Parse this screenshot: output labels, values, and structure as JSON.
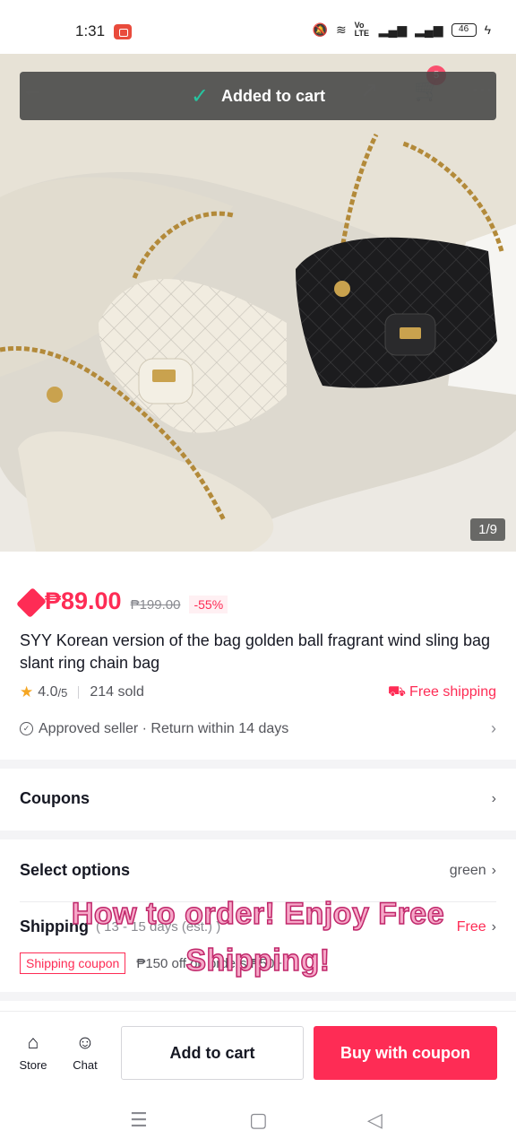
{
  "status_bar": {
    "time": "1:31",
    "network_label": "Vo LTE",
    "battery": "46"
  },
  "toast": {
    "text": "Added to cart"
  },
  "header_icons": {
    "back": "back-arrow-icon",
    "share": "share-icon",
    "cart": "cart-icon",
    "more": "more-icon",
    "cart_badge": "5"
  },
  "gallery": {
    "counter": "1/9"
  },
  "product": {
    "price": "₱89.00",
    "original_price": "₱199.00",
    "discount": "-55%",
    "title": "SYY Korean version of the bag golden ball fragrant wind sling bag slant ring chain bag",
    "rating": "4.0",
    "rating_denominator": "/5",
    "sold": "214 sold",
    "free_shipping": "Free shipping",
    "seller_info": "Approved seller · Return within 14 days"
  },
  "sections": {
    "coupons_label": "Coupons",
    "options_label": "Select options",
    "options_value": "green",
    "shipping_label": "Shipping",
    "shipping_eta": "( 13 - 15 days (est.) )",
    "shipping_value": "Free",
    "shipping_coupon_tag": "Shipping coupon",
    "shipping_coupon_text": "₱150 off on orders ₱50+"
  },
  "overlay": {
    "line1": "How to order! Enjoy Free",
    "line2": "Shipping!"
  },
  "bottom_bar": {
    "store_label": "Store",
    "chat_label": "Chat",
    "add_to_cart": "Add to cart",
    "buy": "Buy with coupon"
  },
  "colors": {
    "accent": "#fe2c55",
    "toast_check": "#27c4a0",
    "overlay_fill": "#f6a8c8"
  }
}
